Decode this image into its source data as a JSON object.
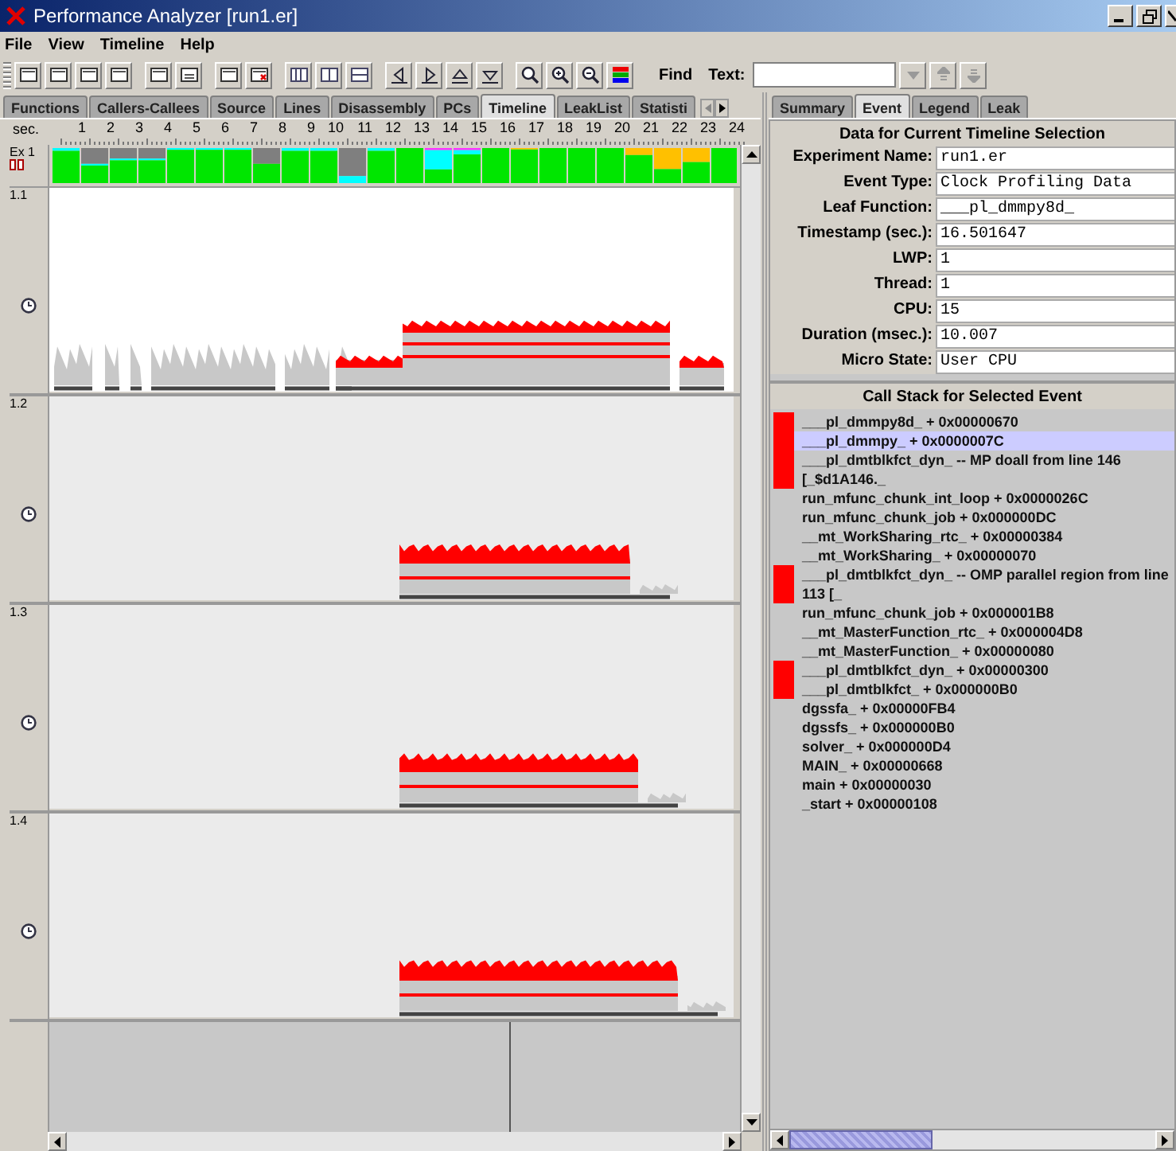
{
  "window": {
    "title": "Performance Analyzer [run1.er]"
  },
  "menu": [
    "File",
    "View",
    "Timeline",
    "Help"
  ],
  "find": {
    "label": "Find",
    "field_label": "Text:"
  },
  "left_tabs": [
    {
      "label": "Functions",
      "selected": false
    },
    {
      "label": "Callers-Callees",
      "selected": false
    },
    {
      "label": "Source",
      "selected": false
    },
    {
      "label": "Lines",
      "selected": false
    },
    {
      "label": "Disassembly",
      "selected": false
    },
    {
      "label": "PCs",
      "selected": false
    },
    {
      "label": "Timeline",
      "selected": true
    },
    {
      "label": "LeakList",
      "selected": false
    },
    {
      "label": "Statisti",
      "selected": false
    }
  ],
  "timeline": {
    "axis_label": "sec.",
    "ticks": [
      "1",
      "2",
      "3",
      "4",
      "5",
      "6",
      "7",
      "8",
      "9",
      "10",
      "11",
      "12",
      "13",
      "14",
      "15",
      "16",
      "17",
      "18",
      "19",
      "20",
      "21",
      "22",
      "23",
      "24"
    ],
    "experiment_label": "Ex 1",
    "lanes": [
      {
        "label": "1.1",
        "selected": true
      },
      {
        "label": "1.2",
        "selected": false
      },
      {
        "label": "1.3",
        "selected": false
      },
      {
        "label": "1.4",
        "selected": false
      }
    ]
  },
  "right_tabs": [
    {
      "label": "Summary",
      "selected": false
    },
    {
      "label": "Event",
      "selected": true
    },
    {
      "label": "Legend",
      "selected": false
    },
    {
      "label": "Leak",
      "selected": false
    }
  ],
  "event": {
    "title": "Data for Current Timeline Selection",
    "fields": [
      {
        "label": "Experiment Name:",
        "value": "run1.er"
      },
      {
        "label": "Event Type:",
        "value": "Clock Profiling Data"
      },
      {
        "label": "Leaf Function:",
        "value": "___pl_dmmpy8d_"
      },
      {
        "label": "Timestamp (sec.):",
        "value": "16.501647"
      },
      {
        "label": "LWP:",
        "value": "1"
      },
      {
        "label": "Thread:",
        "value": "1"
      },
      {
        "label": "CPU:",
        "value": "15"
      },
      {
        "label": "Duration (msec.):",
        "value": "10.007"
      },
      {
        "label": "Micro State:",
        "value": "User CPU"
      }
    ]
  },
  "call_stack": {
    "title": "Call Stack for Selected Event",
    "frames": [
      {
        "text": "___pl_dmmpy8d_ + 0x00000670",
        "marked": true,
        "selected": false
      },
      {
        "text": "___pl_dmmpy_ + 0x0000007C",
        "marked": true,
        "selected": true
      },
      {
        "text": "___pl_dmtblkfct_dyn_ -- MP doall from line 146 [_$d1A146._",
        "marked": true,
        "selected": false
      },
      {
        "text": "run_mfunc_chunk_int_loop + 0x0000026C",
        "marked": false,
        "selected": false
      },
      {
        "text": "run_mfunc_chunk_job + 0x000000DC",
        "marked": false,
        "selected": false
      },
      {
        "text": "__mt_WorkSharing_rtc_ + 0x00000384",
        "marked": false,
        "selected": false
      },
      {
        "text": "__mt_WorkSharing_ + 0x00000070",
        "marked": false,
        "selected": false
      },
      {
        "text": "___pl_dmtblkfct_dyn_ -- OMP parallel region from line 113 [_",
        "marked": true,
        "selected": false
      },
      {
        "text": "run_mfunc_chunk_job + 0x000001B8",
        "marked": false,
        "selected": false
      },
      {
        "text": "__mt_MasterFunction_rtc_ + 0x000004D8",
        "marked": false,
        "selected": false
      },
      {
        "text": "__mt_MasterFunction_ + 0x00000080",
        "marked": false,
        "selected": false
      },
      {
        "text": "___pl_dmtblkfct_dyn_ + 0x00000300",
        "marked": true,
        "selected": false
      },
      {
        "text": "___pl_dmtblkfct_ + 0x000000B0",
        "marked": true,
        "selected": false
      },
      {
        "text": "dgssfa_ + 0x00000FB4",
        "marked": false,
        "selected": false
      },
      {
        "text": "dgssfs_ + 0x000000B0",
        "marked": false,
        "selected": false
      },
      {
        "text": "solver_ + 0x000000D4",
        "marked": false,
        "selected": false
      },
      {
        "text": "MAIN_ + 0x00000668",
        "marked": false,
        "selected": false
      },
      {
        "text": "main + 0x00000030",
        "marked": false,
        "selected": false
      },
      {
        "text": "_start + 0x00000108",
        "marked": false,
        "selected": false
      }
    ]
  }
}
